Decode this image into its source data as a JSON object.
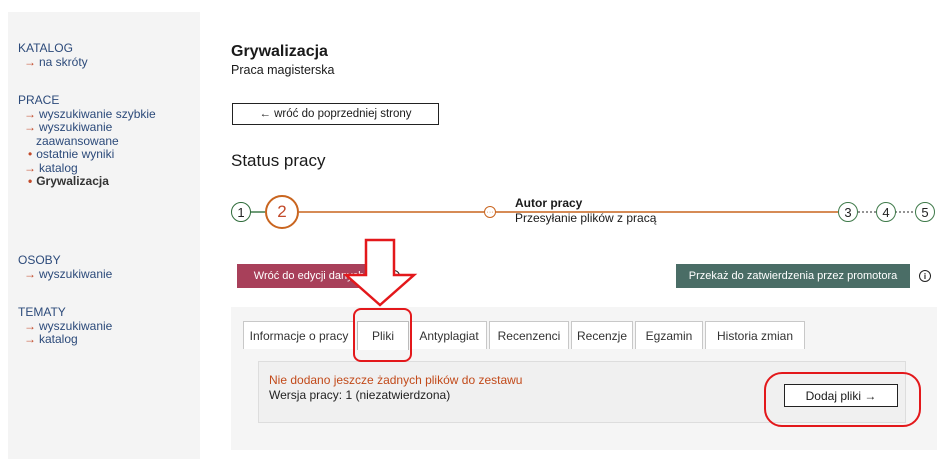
{
  "sidebar": {
    "katalog": {
      "heading": "KATALOG",
      "links": [
        "na skróty"
      ]
    },
    "prace": {
      "heading": "PRACE",
      "items": [
        {
          "label": "wyszukiwanie szybkie"
        },
        {
          "label": "wyszukiwanie",
          "cont": "zaawansowane"
        },
        {
          "label": "ostatnie wyniki",
          "dot": true
        },
        {
          "label": "katalog"
        },
        {
          "label": "Grywalizacja",
          "dot": true,
          "active": true
        }
      ]
    },
    "osoby": {
      "heading": "OSOBY",
      "links": [
        "wyszukiwanie"
      ]
    },
    "tematy": {
      "heading": "TEMATY",
      "links": [
        "wyszukiwanie",
        "katalog"
      ]
    }
  },
  "page": {
    "title": "Grywalizacja",
    "subtitle": "Praca magisterska",
    "back_button": "← wróć do poprzedniej strony",
    "status_title": "Status pracy"
  },
  "stepper": {
    "steps": [
      "1",
      "2",
      "3",
      "4",
      "5"
    ],
    "current_mini": "···",
    "current_role": "Autor pracy",
    "current_task": "Przesyłanie plików z pracą"
  },
  "actions": {
    "back_to_edit": "Wróć do edycji danych",
    "send_to_promoter": "Przekaż do zatwierdzenia przez promotora",
    "info_glyph": "i"
  },
  "tabs": [
    {
      "label": "Informacje o pracy",
      "active": false
    },
    {
      "label": "Pliki",
      "active": true
    },
    {
      "label": "Antyplagiat",
      "active": false
    },
    {
      "label": "Recenzenci",
      "active": false
    },
    {
      "label": "Recenzje",
      "active": false
    },
    {
      "label": "Egzamin",
      "active": false
    },
    {
      "label": "Historia zmian",
      "active": false
    }
  ],
  "files_tab": {
    "warning": "Nie dodano jeszcze żadnych plików do zestawu",
    "version": "Wersja pracy: 1 (niezatwierdzona)",
    "add_button": "Dodaj pliki →"
  },
  "colors": {
    "accent_orange": "#c9651f",
    "step_green": "#3f7a4a",
    "btn_back_edit": "#a8405a",
    "btn_approve": "#4a6d66",
    "annotation_red": "#e3181b",
    "warning_text": "#c24a1a"
  }
}
